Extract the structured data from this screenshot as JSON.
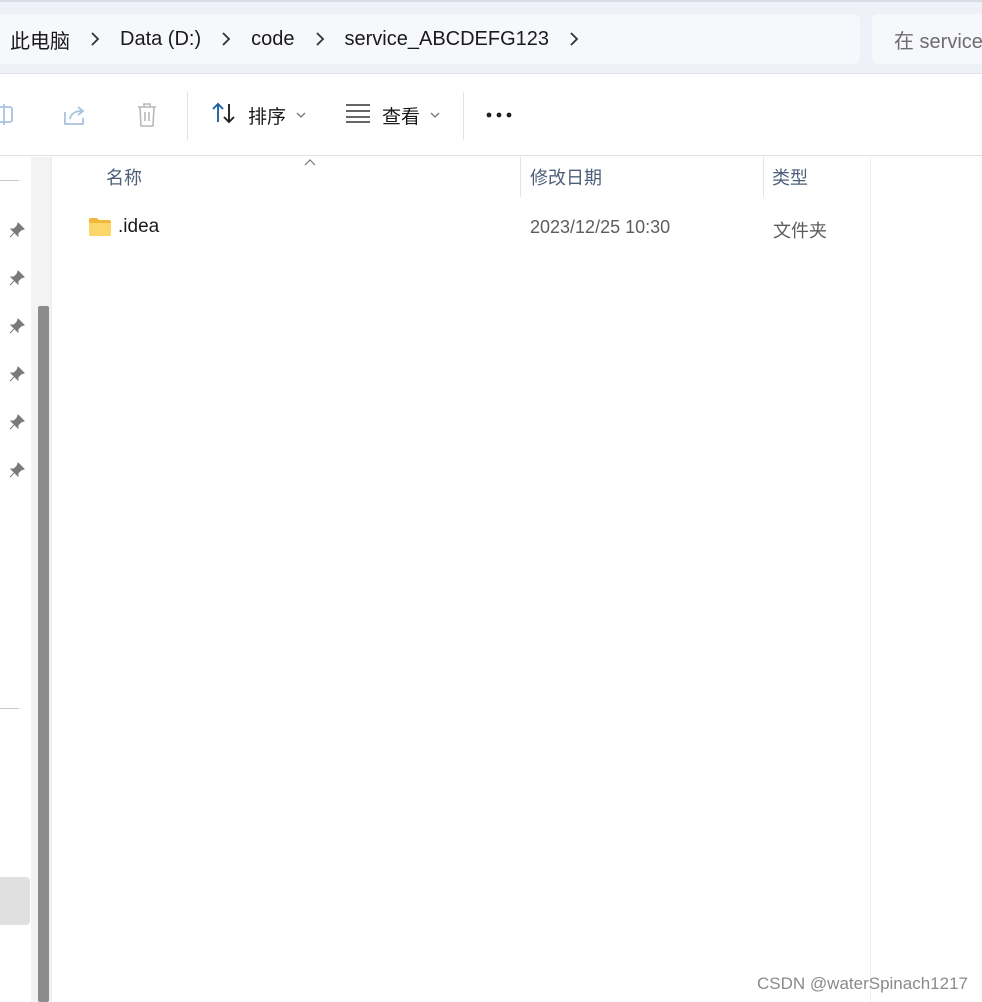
{
  "breadcrumb": {
    "items": [
      "此电脑",
      "Data (D:)",
      "code",
      "service_ABCDEFG123"
    ]
  },
  "search": {
    "placeholder": "在 service"
  },
  "toolbar": {
    "sort_label": "排序",
    "view_label": "查看",
    "more_icon": "more-icon"
  },
  "columns": {
    "name": "名称",
    "date": "修改日期",
    "type": "类型"
  },
  "files": [
    {
      "name": ".idea",
      "modified": "2023/12/25 10:30",
      "type": "文件夹",
      "icon": "folder-icon"
    }
  ],
  "watermark": "CSDN @waterSpinach1217",
  "colors": {
    "address_bg": "#eef1f7",
    "header_text": "#4d5f7a",
    "folder": "#f8c84d",
    "scroll_thumb": "#8c8c8c"
  }
}
